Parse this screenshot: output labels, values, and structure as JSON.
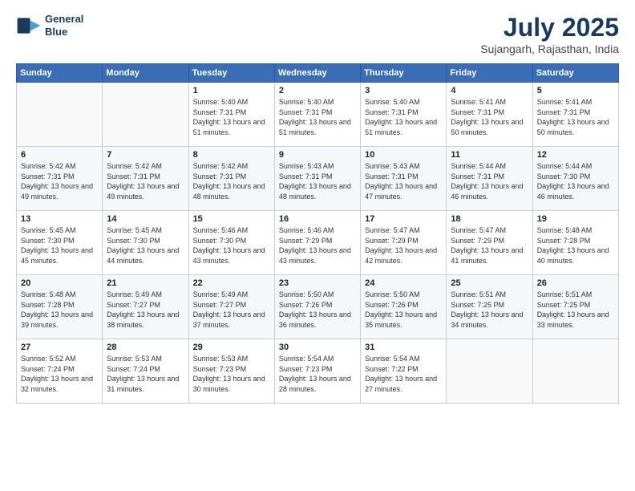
{
  "logo": {
    "line1": "General",
    "line2": "Blue"
  },
  "header": {
    "month": "July 2025",
    "location": "Sujangarh, Rajasthan, India"
  },
  "weekdays": [
    "Sunday",
    "Monday",
    "Tuesday",
    "Wednesday",
    "Thursday",
    "Friday",
    "Saturday"
  ],
  "weeks": [
    [
      {
        "day": "",
        "sunrise": "",
        "sunset": "",
        "daylight": ""
      },
      {
        "day": "",
        "sunrise": "",
        "sunset": "",
        "daylight": ""
      },
      {
        "day": "1",
        "sunrise": "Sunrise: 5:40 AM",
        "sunset": "Sunset: 7:31 PM",
        "daylight": "Daylight: 13 hours and 51 minutes."
      },
      {
        "day": "2",
        "sunrise": "Sunrise: 5:40 AM",
        "sunset": "Sunset: 7:31 PM",
        "daylight": "Daylight: 13 hours and 51 minutes."
      },
      {
        "day": "3",
        "sunrise": "Sunrise: 5:40 AM",
        "sunset": "Sunset: 7:31 PM",
        "daylight": "Daylight: 13 hours and 51 minutes."
      },
      {
        "day": "4",
        "sunrise": "Sunrise: 5:41 AM",
        "sunset": "Sunset: 7:31 PM",
        "daylight": "Daylight: 13 hours and 50 minutes."
      },
      {
        "day": "5",
        "sunrise": "Sunrise: 5:41 AM",
        "sunset": "Sunset: 7:31 PM",
        "daylight": "Daylight: 13 hours and 50 minutes."
      }
    ],
    [
      {
        "day": "6",
        "sunrise": "Sunrise: 5:42 AM",
        "sunset": "Sunset: 7:31 PM",
        "daylight": "Daylight: 13 hours and 49 minutes."
      },
      {
        "day": "7",
        "sunrise": "Sunrise: 5:42 AM",
        "sunset": "Sunset: 7:31 PM",
        "daylight": "Daylight: 13 hours and 49 minutes."
      },
      {
        "day": "8",
        "sunrise": "Sunrise: 5:42 AM",
        "sunset": "Sunset: 7:31 PM",
        "daylight": "Daylight: 13 hours and 48 minutes."
      },
      {
        "day": "9",
        "sunrise": "Sunrise: 5:43 AM",
        "sunset": "Sunset: 7:31 PM",
        "daylight": "Daylight: 13 hours and 48 minutes."
      },
      {
        "day": "10",
        "sunrise": "Sunrise: 5:43 AM",
        "sunset": "Sunset: 7:31 PM",
        "daylight": "Daylight: 13 hours and 47 minutes."
      },
      {
        "day": "11",
        "sunrise": "Sunrise: 5:44 AM",
        "sunset": "Sunset: 7:31 PM",
        "daylight": "Daylight: 13 hours and 46 minutes."
      },
      {
        "day": "12",
        "sunrise": "Sunrise: 5:44 AM",
        "sunset": "Sunset: 7:30 PM",
        "daylight": "Daylight: 13 hours and 46 minutes."
      }
    ],
    [
      {
        "day": "13",
        "sunrise": "Sunrise: 5:45 AM",
        "sunset": "Sunset: 7:30 PM",
        "daylight": "Daylight: 13 hours and 45 minutes."
      },
      {
        "day": "14",
        "sunrise": "Sunrise: 5:45 AM",
        "sunset": "Sunset: 7:30 PM",
        "daylight": "Daylight: 13 hours and 44 minutes."
      },
      {
        "day": "15",
        "sunrise": "Sunrise: 5:46 AM",
        "sunset": "Sunset: 7:30 PM",
        "daylight": "Daylight: 13 hours and 43 minutes."
      },
      {
        "day": "16",
        "sunrise": "Sunrise: 5:46 AM",
        "sunset": "Sunset: 7:29 PM",
        "daylight": "Daylight: 13 hours and 43 minutes."
      },
      {
        "day": "17",
        "sunrise": "Sunrise: 5:47 AM",
        "sunset": "Sunset: 7:29 PM",
        "daylight": "Daylight: 13 hours and 42 minutes."
      },
      {
        "day": "18",
        "sunrise": "Sunrise: 5:47 AM",
        "sunset": "Sunset: 7:29 PM",
        "daylight": "Daylight: 13 hours and 41 minutes."
      },
      {
        "day": "19",
        "sunrise": "Sunrise: 5:48 AM",
        "sunset": "Sunset: 7:28 PM",
        "daylight": "Daylight: 13 hours and 40 minutes."
      }
    ],
    [
      {
        "day": "20",
        "sunrise": "Sunrise: 5:48 AM",
        "sunset": "Sunset: 7:28 PM",
        "daylight": "Daylight: 13 hours and 39 minutes."
      },
      {
        "day": "21",
        "sunrise": "Sunrise: 5:49 AM",
        "sunset": "Sunset: 7:27 PM",
        "daylight": "Daylight: 13 hours and 38 minutes."
      },
      {
        "day": "22",
        "sunrise": "Sunrise: 5:49 AM",
        "sunset": "Sunset: 7:27 PM",
        "daylight": "Daylight: 13 hours and 37 minutes."
      },
      {
        "day": "23",
        "sunrise": "Sunrise: 5:50 AM",
        "sunset": "Sunset: 7:26 PM",
        "daylight": "Daylight: 13 hours and 36 minutes."
      },
      {
        "day": "24",
        "sunrise": "Sunrise: 5:50 AM",
        "sunset": "Sunset: 7:26 PM",
        "daylight": "Daylight: 13 hours and 35 minutes."
      },
      {
        "day": "25",
        "sunrise": "Sunrise: 5:51 AM",
        "sunset": "Sunset: 7:25 PM",
        "daylight": "Daylight: 13 hours and 34 minutes."
      },
      {
        "day": "26",
        "sunrise": "Sunrise: 5:51 AM",
        "sunset": "Sunset: 7:25 PM",
        "daylight": "Daylight: 13 hours and 33 minutes."
      }
    ],
    [
      {
        "day": "27",
        "sunrise": "Sunrise: 5:52 AM",
        "sunset": "Sunset: 7:24 PM",
        "daylight": "Daylight: 13 hours and 32 minutes."
      },
      {
        "day": "28",
        "sunrise": "Sunrise: 5:53 AM",
        "sunset": "Sunset: 7:24 PM",
        "daylight": "Daylight: 13 hours and 31 minutes."
      },
      {
        "day": "29",
        "sunrise": "Sunrise: 5:53 AM",
        "sunset": "Sunset: 7:23 PM",
        "daylight": "Daylight: 13 hours and 30 minutes."
      },
      {
        "day": "30",
        "sunrise": "Sunrise: 5:54 AM",
        "sunset": "Sunset: 7:23 PM",
        "daylight": "Daylight: 13 hours and 28 minutes."
      },
      {
        "day": "31",
        "sunrise": "Sunrise: 5:54 AM",
        "sunset": "Sunset: 7:22 PM",
        "daylight": "Daylight: 13 hours and 27 minutes."
      },
      {
        "day": "",
        "sunrise": "",
        "sunset": "",
        "daylight": ""
      },
      {
        "day": "",
        "sunrise": "",
        "sunset": "",
        "daylight": ""
      }
    ]
  ]
}
